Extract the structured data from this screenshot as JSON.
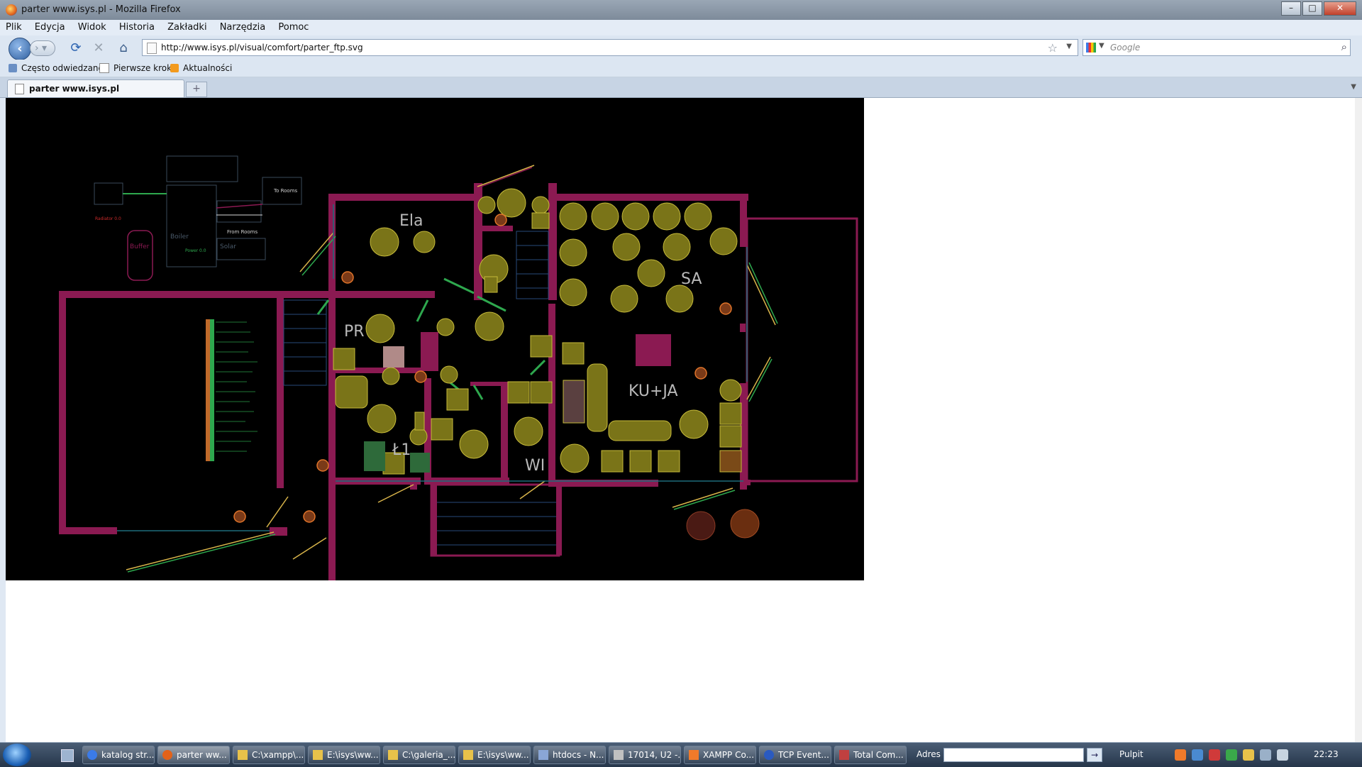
{
  "window": {
    "title": "parter www.isys.pl - Mozilla Firefox"
  },
  "menu": [
    "Plik",
    "Edycja",
    "Widok",
    "Historia",
    "Zakładki",
    "Narzędzia",
    "Pomoc"
  ],
  "nav": {
    "url": "http://www.isys.pl/visual/comfort/parter_ftp.svg",
    "search_placeholder": "Google"
  },
  "bookmarks": [
    "Często odwiedzane",
    "Pierwsze kroki",
    "Aktualności"
  ],
  "tabs": [
    {
      "label": "parter www.isys.pl"
    }
  ],
  "plan": {
    "rooms": {
      "ela": "Ela",
      "sa": "SA",
      "pr": "PR",
      "ku_ja": "KU+JA",
      "l1": "Ł1",
      "wi": "WI"
    },
    "labels": {
      "to_rooms": "To Rooms",
      "from_rooms": "From Rooms",
      "buffer": "Buffer",
      "boiler": "Boiler",
      "solar": "Solar",
      "radiator": "Radiator 0.0",
      "power": "Power 0.0"
    }
  },
  "taskbar": {
    "buttons": [
      "katalog str...",
      "parter ww...",
      "C:\\xampp\\...",
      "E:\\isys\\ww...",
      "C:\\galeria_...",
      "E:\\isys\\ww...",
      "htdocs - N...",
      "17014, U2 -...",
      "XAMPP Co...",
      "TCP Event...",
      "Total Com..."
    ],
    "address_label": "Adres",
    "desktop_label": "Pulpit",
    "clock": "22:23"
  }
}
